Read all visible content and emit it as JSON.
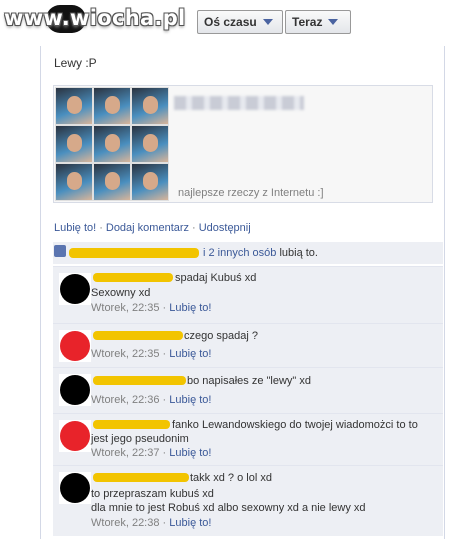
{
  "watermark": "www.wiocha.pl",
  "filters": {
    "axis_label": "Oś czasu",
    "time_label": "Teraz"
  },
  "post": {
    "text": "Lewy :P",
    "link_description": "najlepsze rzeczy z Internetu :]"
  },
  "actions": {
    "like": "Lubię to!",
    "comment": "Dodaj komentarz",
    "share": "Udostępnij"
  },
  "likes": {
    "others_link": "i 2 innych osób",
    "suffix": "lubią to."
  },
  "comments": [
    {
      "avatar_color": "#000000",
      "lines": [
        "spadaj Kubuś xd",
        "Sexowny xd"
      ],
      "time": "Wtorek, 22:35",
      "like": "Lubię to!"
    },
    {
      "avatar_color": "#e8232a",
      "lines": [
        "czego spadaj ?"
      ],
      "time": "Wtorek, 22:35",
      "like": "Lubię to!"
    },
    {
      "avatar_color": "#000000",
      "lines": [
        "bo napisałes ze \"lewy\" xd"
      ],
      "time": "Wtorek, 22:36",
      "like": "Lubię to!"
    },
    {
      "avatar_color": "#e8232a",
      "lines": [
        "fanko Lewandowskiego do twojej wiadomożci to to",
        "jest jego pseudonim"
      ],
      "time": "Wtorek, 22:37",
      "like": "Lubię to!"
    },
    {
      "avatar_color": "#000000",
      "lines": [
        "takk xd ? o lol xd",
        "to przepraszam kubuś xd",
        "dla mnie to jest Robuś xd albo sexowny xd a nie lewy xd"
      ],
      "time": "Wtorek, 22:38",
      "like": "Lubię to!"
    }
  ]
}
